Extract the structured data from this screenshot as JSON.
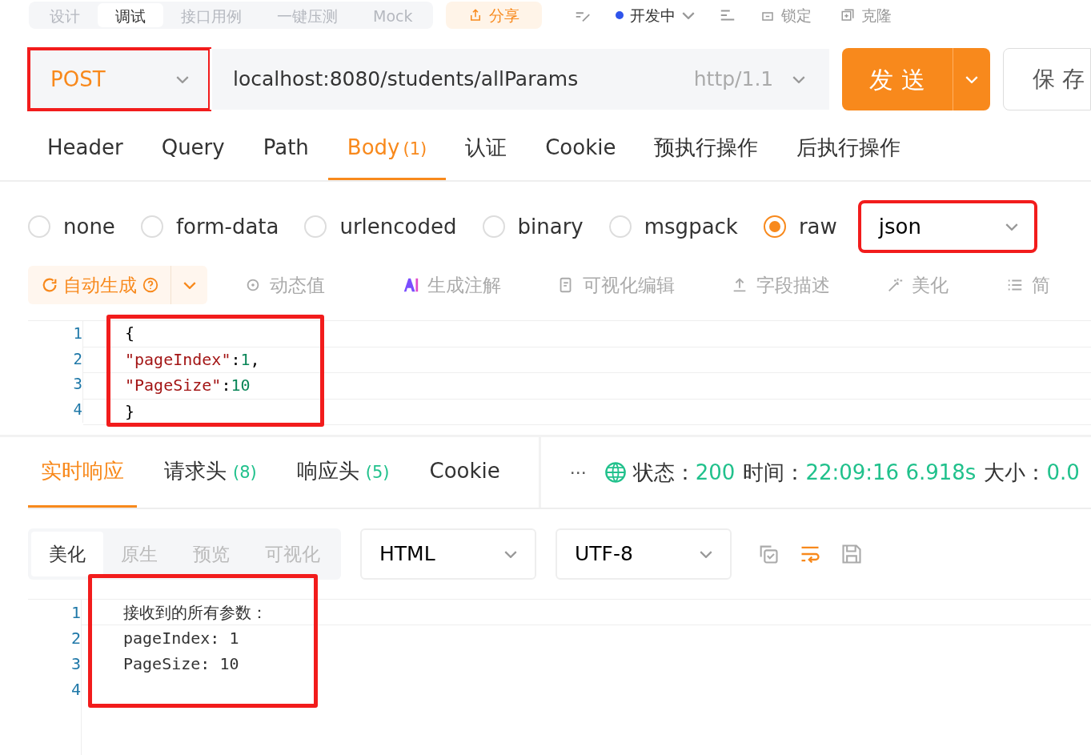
{
  "top_tabs": [
    {
      "label": "设计",
      "selected": false
    },
    {
      "label": "调试",
      "selected": true
    },
    {
      "label": "接口用例",
      "selected": false
    },
    {
      "label": "一键压测",
      "selected": false
    },
    {
      "label": "Mock",
      "selected": false
    }
  ],
  "share_button": "分享",
  "api_status": {
    "label": "开发中",
    "color": "#2f54eb"
  },
  "top_actions": [
    {
      "label": "锁定",
      "kind": "lock"
    },
    {
      "label": "克隆",
      "kind": "clone"
    }
  ],
  "request": {
    "method": "POST",
    "method_highlighted": true,
    "url": "localhost:8080/students/allParams",
    "protocol": "http/1.1",
    "send_label": "发 送",
    "save_label": "保 存"
  },
  "request_tabs": [
    {
      "label": "Header",
      "selected": false
    },
    {
      "label": "Query",
      "selected": false
    },
    {
      "label": "Path",
      "selected": false
    },
    {
      "label": "Body",
      "count": "(1)",
      "selected": true
    },
    {
      "label": "认证",
      "selected": false
    },
    {
      "label": "Cookie",
      "selected": false
    },
    {
      "label": "预执行操作",
      "selected": false
    },
    {
      "label": "后执行操作",
      "selected": false
    }
  ],
  "body_types": [
    {
      "label": "none",
      "selected": false
    },
    {
      "label": "form-data",
      "selected": false
    },
    {
      "label": "urlencoded",
      "selected": false
    },
    {
      "label": "binary",
      "selected": false
    },
    {
      "label": "msgpack",
      "selected": false
    },
    {
      "label": "raw",
      "selected": true
    }
  ],
  "body_format": {
    "value": "json",
    "highlighted": true
  },
  "body_tools": [
    {
      "kind": "auto",
      "label": "自动生成"
    },
    {
      "kind": "dynamic",
      "label": "动态值"
    },
    {
      "kind": "ai",
      "label": "生成注解"
    },
    {
      "kind": "visual",
      "label": "可视化编辑"
    },
    {
      "kind": "fields",
      "label": "字段描述"
    },
    {
      "kind": "beautify",
      "label": "美化"
    },
    {
      "kind": "list",
      "label": "简"
    }
  ],
  "request_code": {
    "highlighted": true,
    "lines": [
      {
        "number": "1",
        "tokens": [
          {
            "kind": "punct",
            "text": "{"
          }
        ]
      },
      {
        "number": "2",
        "tokens": [
          {
            "kind": "key",
            "text": "\"pageIndex\""
          },
          {
            "kind": "punct",
            "text": ":"
          },
          {
            "kind": "number",
            "text": "1"
          },
          {
            "kind": "punct",
            "text": ","
          }
        ]
      },
      {
        "number": "3",
        "tokens": [
          {
            "kind": "key",
            "text": "\"PageSize\""
          },
          {
            "kind": "punct",
            "text": ":"
          },
          {
            "kind": "number",
            "text": "10"
          }
        ]
      },
      {
        "number": "4",
        "tokens": [
          {
            "kind": "punct",
            "text": "}"
          }
        ]
      }
    ]
  },
  "response_tabs": [
    {
      "label": "实时响应",
      "selected": true
    },
    {
      "label": "请求头",
      "count": "(8)",
      "selected": false
    },
    {
      "label": "响应头",
      "count": "(5)",
      "selected": false
    },
    {
      "label": "Cookie",
      "selected": false
    }
  ],
  "more_button": "···",
  "response_status": [
    {
      "label": "状态：",
      "value": "200"
    },
    {
      "label": "时间：",
      "value": "22:09:16  6.918s"
    },
    {
      "label": "大小：",
      "value": "0.0"
    }
  ],
  "view_modes": [
    {
      "label": "美化",
      "selected": true
    },
    {
      "label": "原生",
      "selected": false
    },
    {
      "label": "预览",
      "selected": false
    },
    {
      "label": "可视化",
      "selected": false
    }
  ],
  "response_format": "HTML",
  "response_encoding": "UTF-8",
  "response_code": {
    "highlighted": true,
    "lines": [
      {
        "number": "1",
        "text": "接收到的所有参数："
      },
      {
        "number": "2",
        "text": "pageIndex: 1"
      },
      {
        "number": "3",
        "text": "PageSize: 10"
      },
      {
        "number": "4"
      }
    ]
  }
}
